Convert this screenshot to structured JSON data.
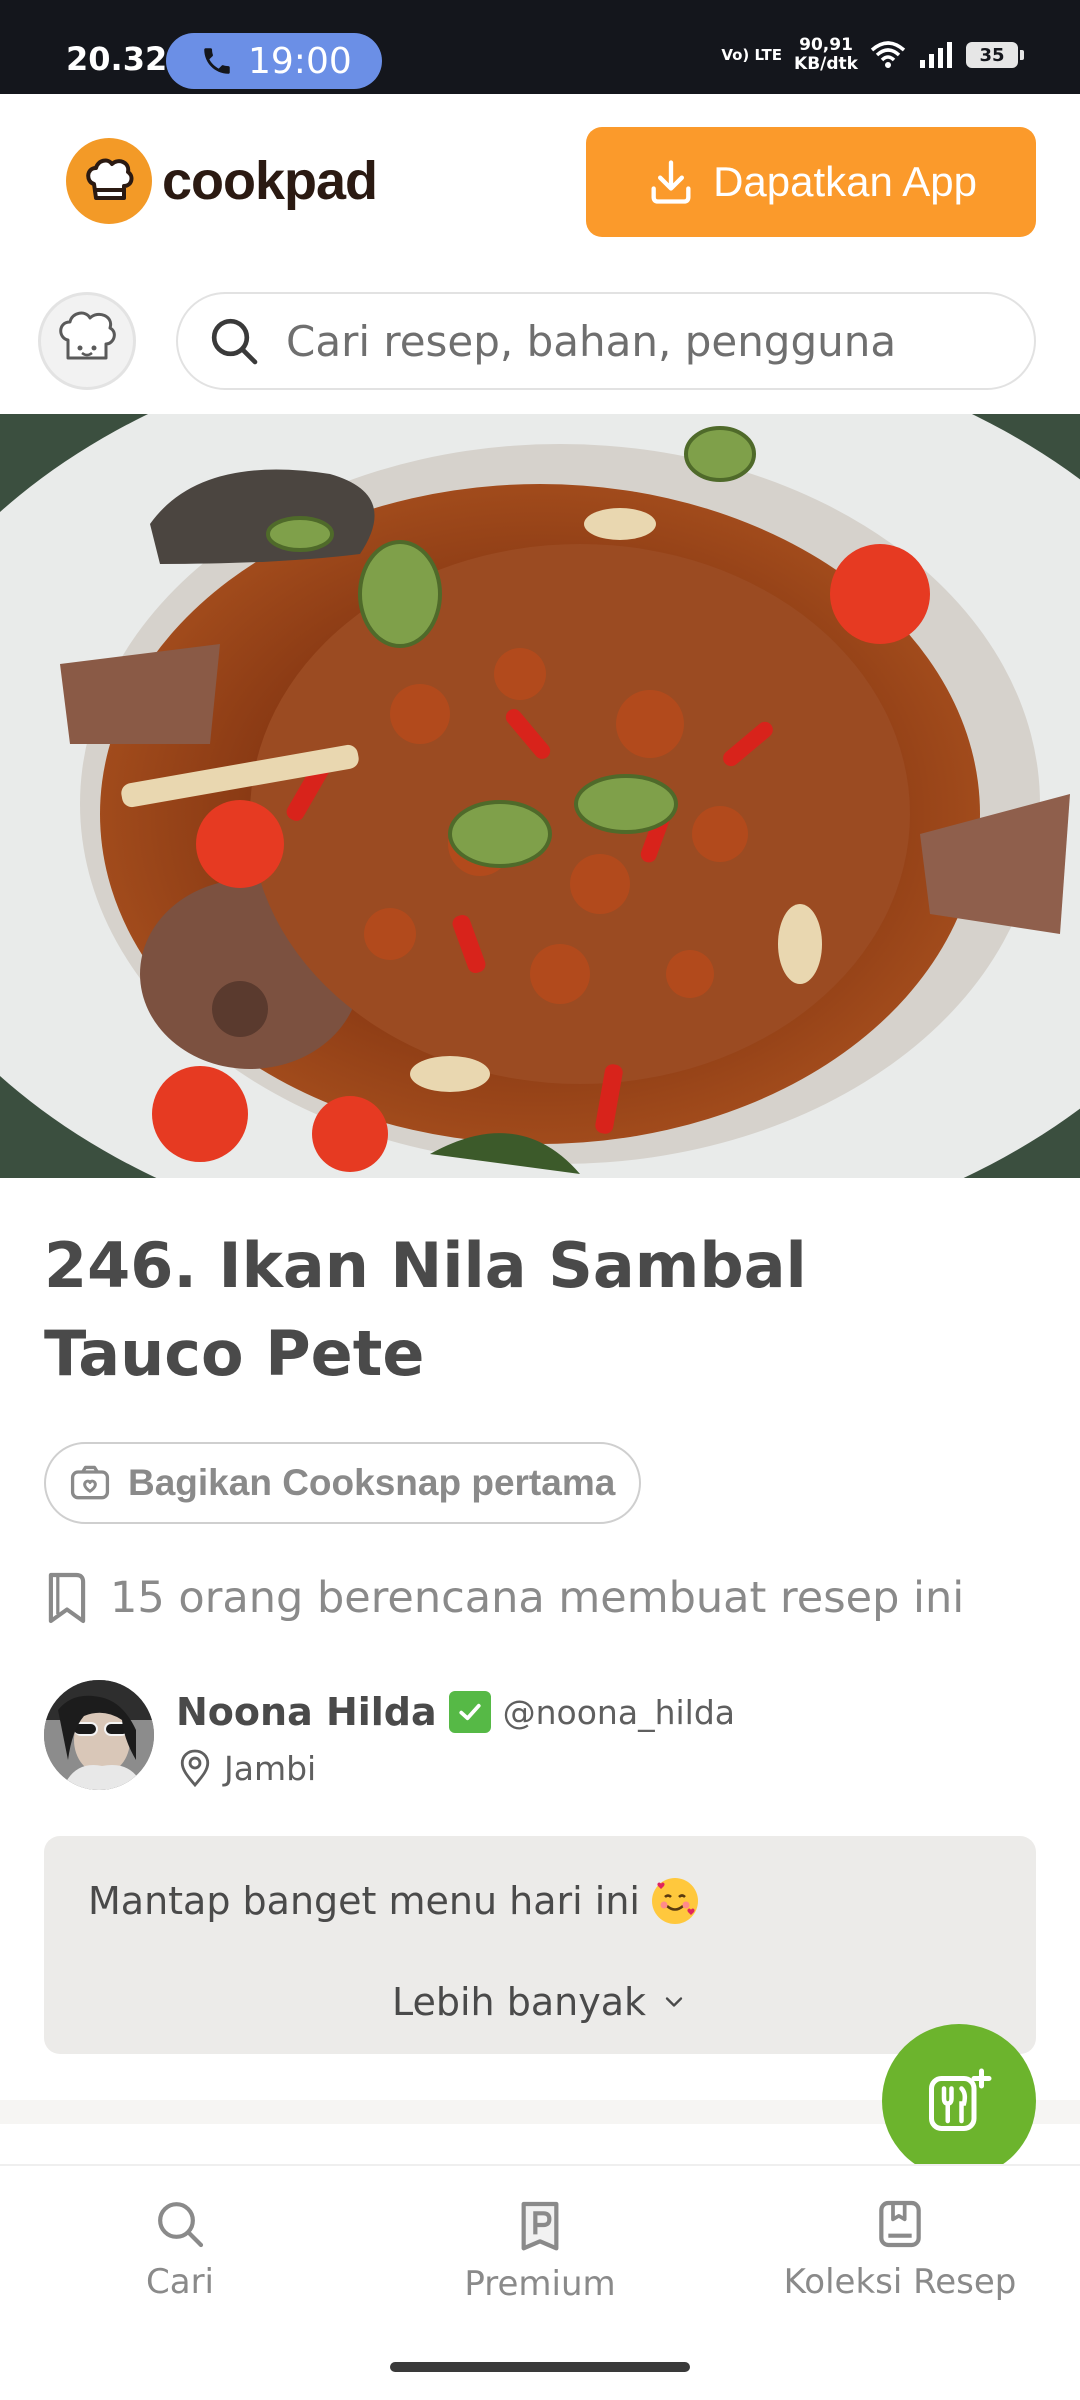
{
  "status_bar": {
    "time": "20.32",
    "call_time": "19:00",
    "network_label": "Vo) LTE",
    "speed_value": "90,91",
    "speed_unit": "KB/dtk",
    "battery": "35"
  },
  "header": {
    "brand": "cookpad",
    "get_app_label": "Dapatkan App"
  },
  "search": {
    "placeholder": "Cari resep, bahan, pengguna"
  },
  "recipe": {
    "title": "246. Ikan Nila Sambal Tauco Pete",
    "cooksnap_label": "Bagikan Cooksnap pertama",
    "plans_text": "15 orang berencana membuat resep ini"
  },
  "author": {
    "name": "Noona Hilda",
    "handle": "@noona_hilda",
    "location": "Jambi"
  },
  "story": {
    "text": "Mantap banget menu hari ini",
    "more_label": "Lebih banyak"
  },
  "bottom_nav": {
    "items": [
      {
        "label": "Cari",
        "icon": "search-icon"
      },
      {
        "label": "Premium",
        "icon": "premium-icon"
      },
      {
        "label": "Koleksi Resep",
        "icon": "collection-icon"
      }
    ]
  },
  "colors": {
    "brand_orange": "#fb9a2b",
    "fab_green": "#6cb42d",
    "status_bar": "#14161c"
  }
}
